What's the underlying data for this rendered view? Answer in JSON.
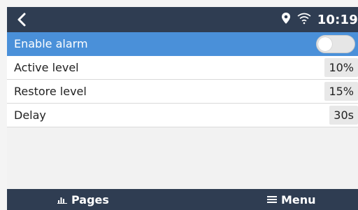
{
  "topbar": {
    "back_icon": "chevron-left-icon",
    "location_icon": "location-pin-icon",
    "wifi_icon": "wifi-icon",
    "time": "10:19"
  },
  "settings": {
    "rows": [
      {
        "label": "Enable alarm",
        "control": "toggle",
        "state": "off",
        "selected": true
      },
      {
        "label": "Active level",
        "value": "10%"
      },
      {
        "label": "Restore level",
        "value": "15%"
      },
      {
        "label": "Delay",
        "value": "30s"
      }
    ]
  },
  "bottombar": {
    "pages_label": "Pages",
    "pages_icon": "bar-chart-icon",
    "menu_label": "Menu",
    "menu_icon": "hamburger-menu-icon"
  },
  "colors": {
    "bar_background": "#2f3d52",
    "selected_row": "#4a90d9",
    "content_background": "#f2f2f2"
  }
}
